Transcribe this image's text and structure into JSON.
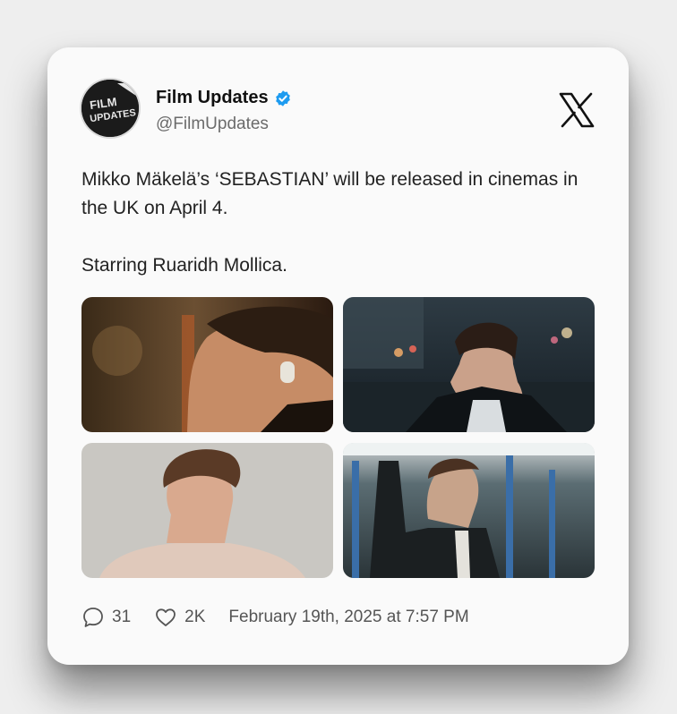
{
  "account": {
    "display_name": "Film Updates",
    "handle": "@FilmUpdates",
    "avatar_text_top": "FILM",
    "avatar_text_bottom": "UPDATES"
  },
  "tweet": {
    "line1": "Mikko Mäkelä’s ‘SEBASTIAN’ will be released in cinemas in the UK on April 4.",
    "line2": "Starring Ruaridh Mollica."
  },
  "stats": {
    "replies": "31",
    "likes": "2K",
    "timestamp": "February 19th, 2025 at 7:57 PM"
  },
  "colors": {
    "verified": "#1d9bf0",
    "text": "#222222",
    "muted": "#6b6b6b"
  },
  "icons": [
    "verified-badge-icon",
    "x-logo-icon",
    "reply-icon",
    "heart-icon"
  ]
}
